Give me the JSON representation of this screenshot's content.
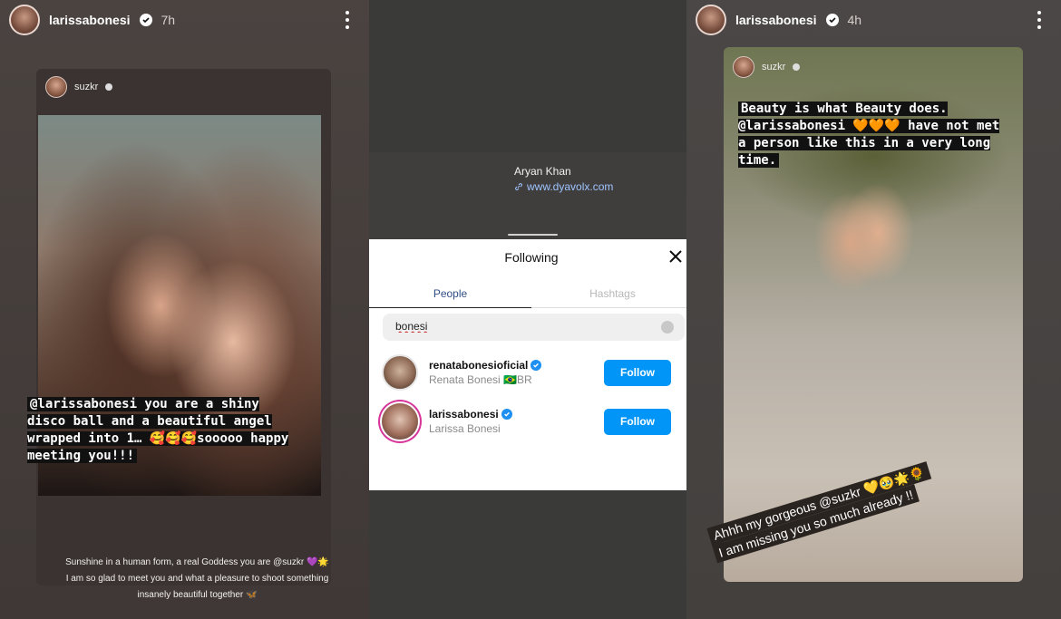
{
  "left_story": {
    "username": "larissabonesi",
    "time": "7h",
    "card": {
      "username": "suzkr",
      "caption": "@larissabonesi you are a shiny disco ball and a beautiful angel wrapped into 1… 🥰🥰🥰sooooo happy meeting you!!!",
      "subcaption_line1": "Sunshine in a human form, a real Goddess you are @suzkr 💜🌟",
      "subcaption_line2": "I am so glad to meet you and what a pleasure to shoot something",
      "subcaption_line3": "insanely beautiful together 🦋"
    }
  },
  "middle": {
    "profile_name": "Aryan Khan",
    "profile_link": "www.dyavolx.com",
    "modal": {
      "title": "Following",
      "tabs": [
        "People",
        "Hashtags"
      ],
      "search_value": "bonesi",
      "results": [
        {
          "username": "renatabonesioficial",
          "name": "Renata Bonesi 🇧🇷BR",
          "button": "Follow"
        },
        {
          "username": "larissabonesi",
          "name": "Larissa Bonesi",
          "button": "Follow"
        }
      ]
    }
  },
  "right_story": {
    "username": "larissabonesi",
    "time": "4h",
    "card": {
      "username": "suzkr",
      "caption": "Beauty is what Beauty does. @larissabonesi 🧡🧡🧡 have not met a person like this in a very long time.",
      "sticker_line1": "Ahhh my gorgeous @suzkr 💛🥹🌟🌻",
      "sticker_line2": "I am missing you so much already !!"
    }
  },
  "colors": {
    "follow_button": "#0095f6",
    "verified": "#1d90f2",
    "active_tab": "#2f4e85"
  }
}
